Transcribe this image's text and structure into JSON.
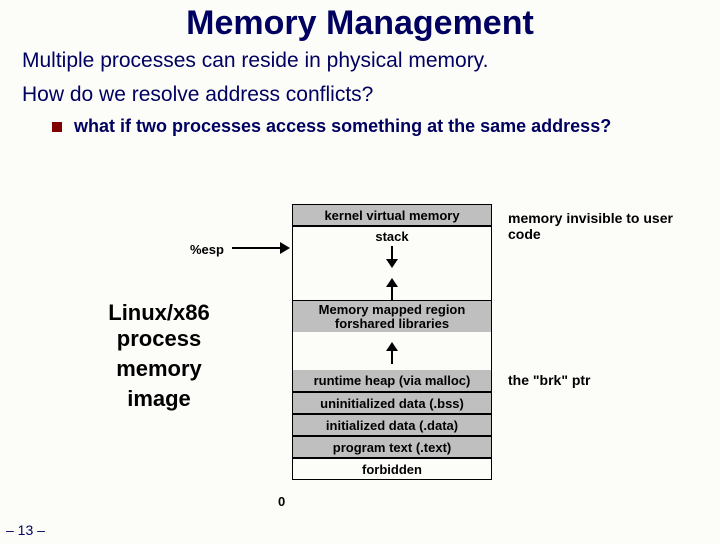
{
  "title": "Memory Management",
  "line1": "Multiple processes can reside in physical memory.",
  "line2": "How do we resolve address conflicts?",
  "bullet": "what if two processes access something at the same address?",
  "esp": "%esp",
  "side": {
    "a": "Linux/x86 process",
    "b": "memory",
    "c": "image"
  },
  "mem": {
    "kernel": "kernel virtual memory",
    "stack": "stack",
    "mmap": "Memory mapped region forshared libraries",
    "heap": "runtime heap (via malloc)",
    "bss": "uninitialized data (.bss)",
    "data": "initialized data (.data)",
    "text": "program text (.text)",
    "forbidden": "forbidden"
  },
  "note": {
    "a": "memory invisible to user code",
    "b": "the \"brk\" ptr"
  },
  "zero": "0",
  "pagenum": "– 13 –"
}
